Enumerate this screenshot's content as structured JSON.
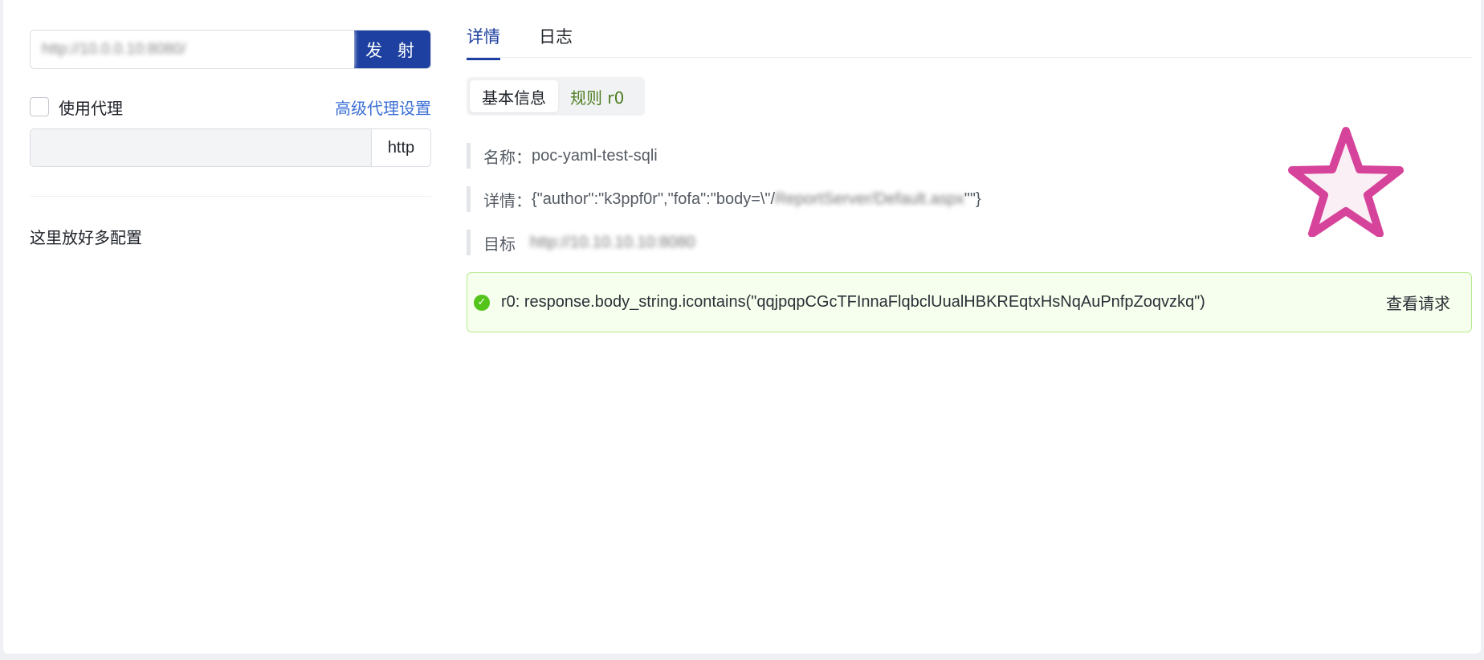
{
  "request": {
    "url_value": "http://10.0.0.10:8080/",
    "send_label": "发 射"
  },
  "proxy": {
    "use_proxy_label": "使用代理",
    "use_proxy_checked": false,
    "advanced_link": "高级代理设置",
    "address_value": "",
    "scheme": "http"
  },
  "config_placeholder_text": "这里放好多配置",
  "tabs": [
    {
      "label": "详情",
      "active": true
    },
    {
      "label": "日志",
      "active": false
    }
  ],
  "segments": [
    {
      "label": "基本信息",
      "active": true
    },
    {
      "label": "规则 r0",
      "active": false
    }
  ],
  "info": {
    "name_label": "名称：",
    "name_value": "poc-yaml-test-sqli",
    "detail_label": "详情：",
    "detail_value": "{\"author\":\"k3ppf0r\",\"fofa\":\"body=\\\"/",
    "detail_blurred": "ReportServer/Default.aspx",
    "detail_suffix": "\"\"}",
    "target_label": "目标",
    "target_value": "http://10.10.10.10:8080"
  },
  "result": {
    "status": "success",
    "expression": "r0: response.body_string.icontains(\"qqjpqpCGcTFInnaFlqbclUualHBKREqtxHsNqAuPnfpZoqvzkq\")",
    "view_request_label": "查看请求"
  },
  "colors": {
    "primary": "#1e40a0",
    "link": "#3b6fd6",
    "success": "#52c41a",
    "success_bg": "#f6ffed",
    "star_stroke": "#d6439a",
    "star_fill": "#fbeff6"
  }
}
